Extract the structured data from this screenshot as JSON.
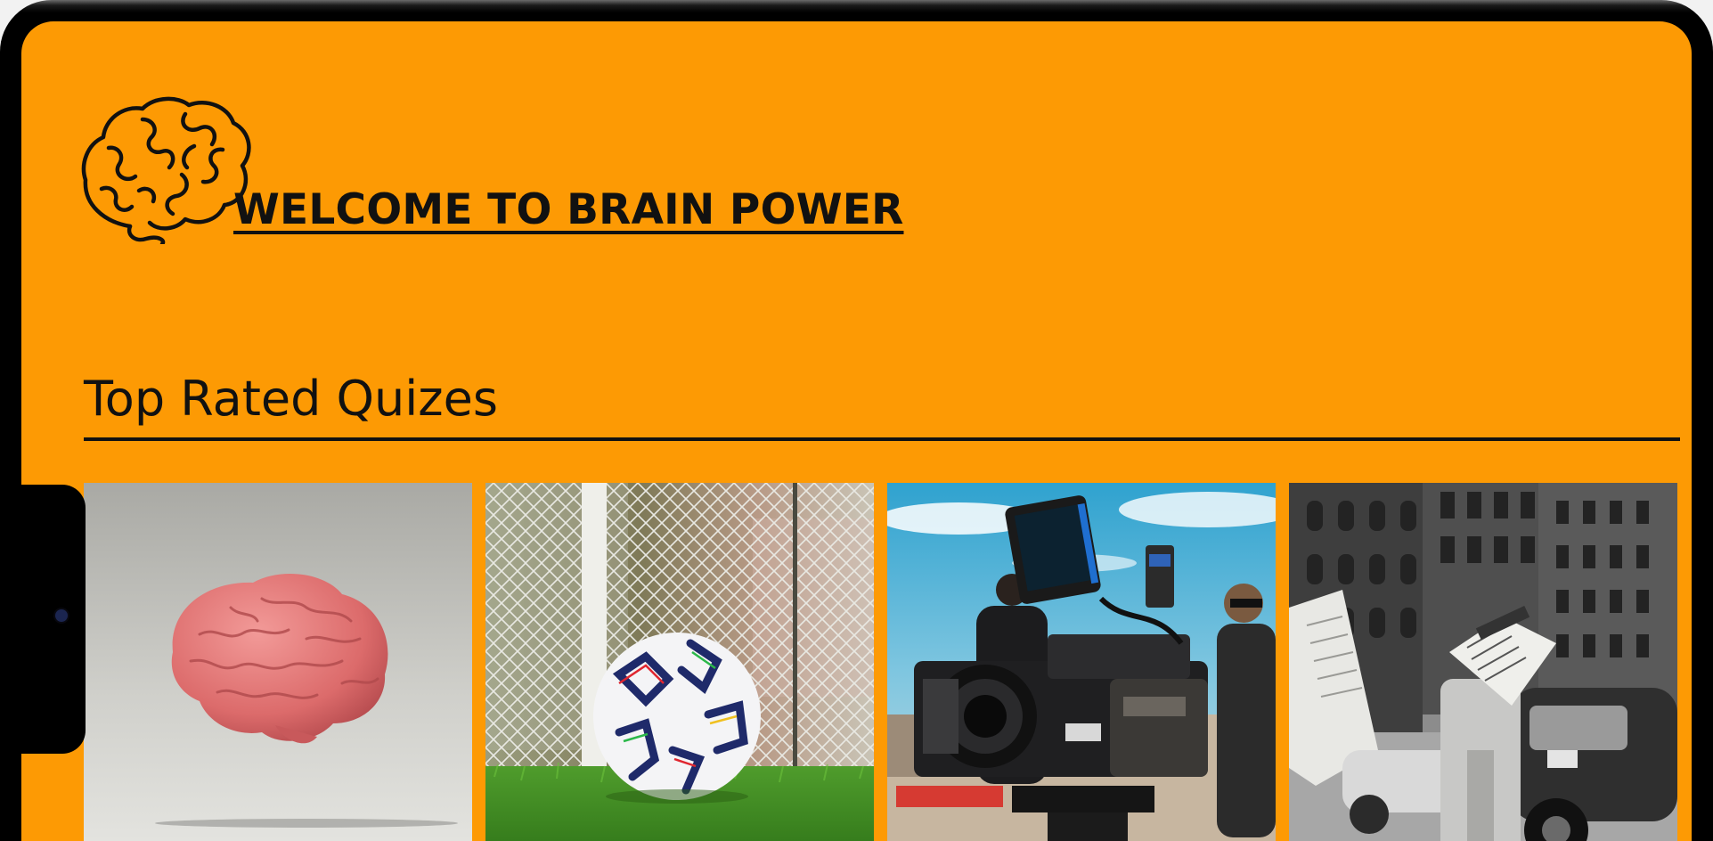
{
  "page": {
    "title": "WELCOME TO BRAIN POWER",
    "section_title": "Top Rated Quizes"
  },
  "logo": {
    "icon": "brain-outline-icon",
    "color": "#111111"
  },
  "colors": {
    "background": "#fd9a04",
    "text": "#111111",
    "device_frame": "#000000"
  },
  "quizzes": [
    {
      "image": "pink-brain-photo"
    },
    {
      "image": "soccer-ball-photo"
    },
    {
      "image": "film-camera-photo"
    },
    {
      "image": "vintage-newspaper-street-photo"
    }
  ]
}
